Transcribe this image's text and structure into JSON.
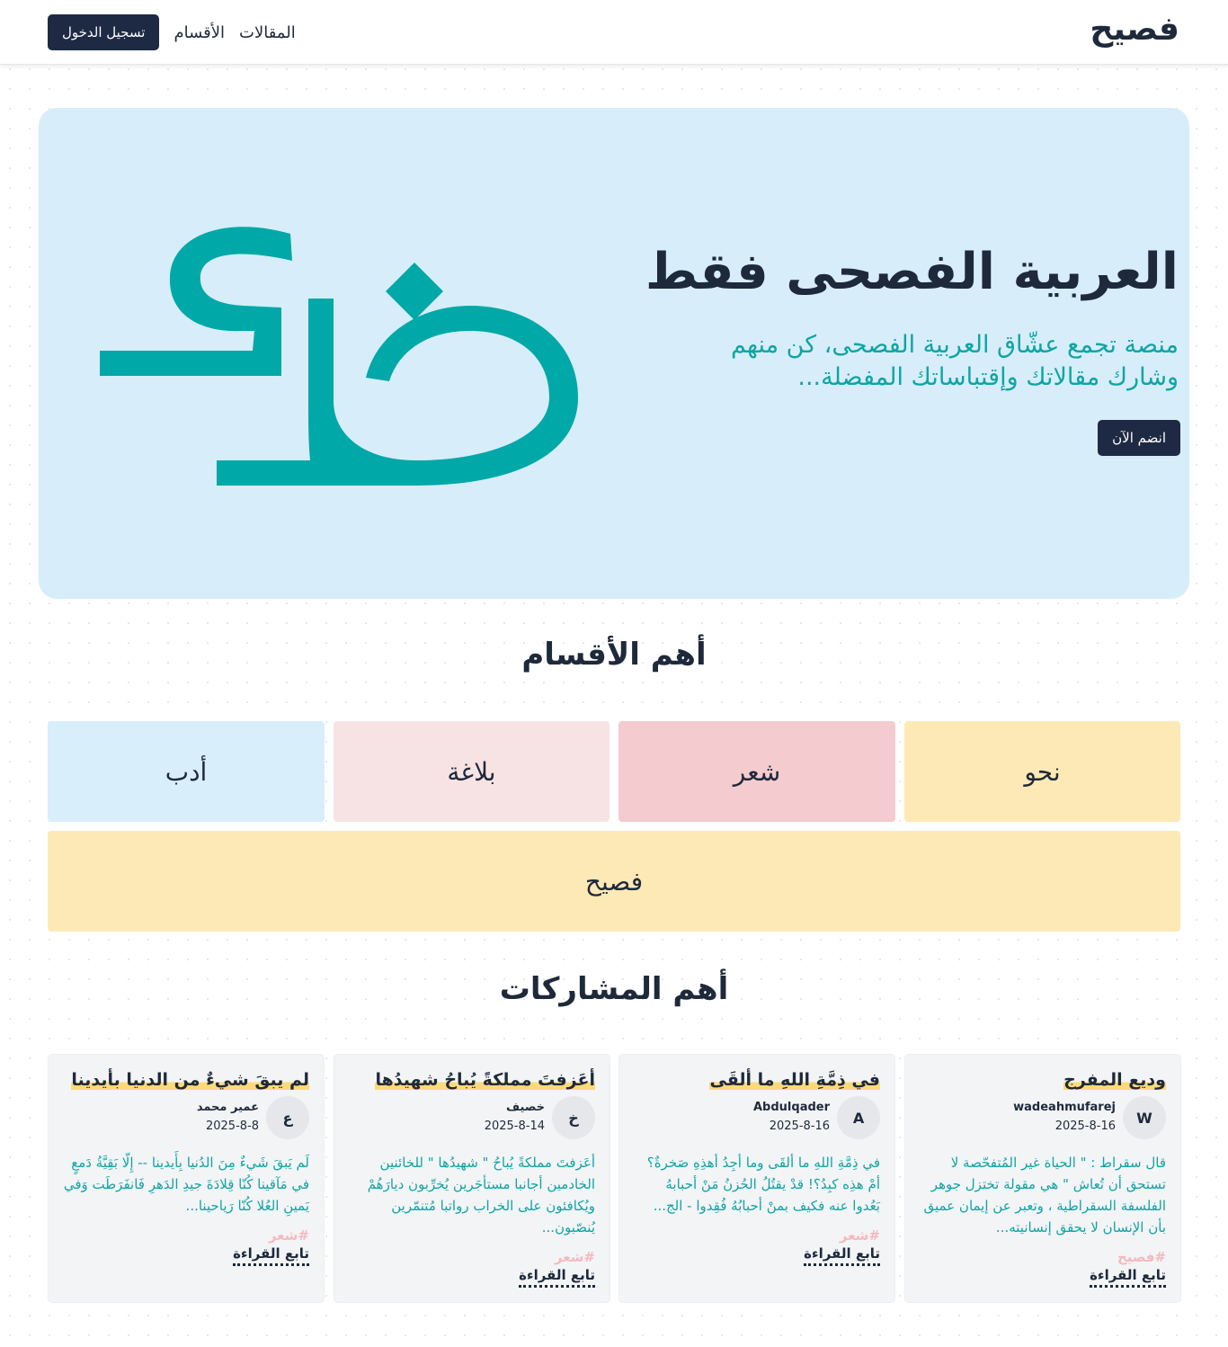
{
  "brand": {
    "logo": "فصيح"
  },
  "nav": {
    "login_label": "تسجيل الدخول",
    "categories_label": "الأقسام",
    "articles_label": "المقالات"
  },
  "hero": {
    "title": "العربية الفصحى فقط",
    "subtitle": "منصة تجمع عشّاق العربية الفصحى، كن منهم وشارك مقالاتك وإقتباساتك المفضلة...",
    "cta_label": "انضم الآن",
    "art_letters": "ضع",
    "colors": {
      "background": "#d7edf9",
      "accent": "#00a8a8"
    }
  },
  "categories_section": {
    "title": "أهم الأقسام",
    "items": [
      {
        "label": "نحو",
        "color": "#fde9b5"
      },
      {
        "label": "شعر",
        "color": "#f4cbcf"
      },
      {
        "label": "بلاغة",
        "color": "#f8e3e4"
      },
      {
        "label": "أدب",
        "color": "#d8eefa"
      },
      {
        "label": "فصيح",
        "color": "#fde9b5"
      }
    ]
  },
  "posts_section": {
    "title": "أهم المشاركات",
    "read_more_label": "تابع القراءة",
    "posts": [
      {
        "title": "وديع المفرج",
        "author": "wadeahmufarej",
        "avatar": "W",
        "date": "2025-8-16",
        "excerpt": "قال سقراط : \" الحياة غير المُتفحّصة لا تستحق أن تُعاش \" هي مقولة تختزل جوهر الفلسفة السقراطية ، وتعبر عن إيمان عميق بأن الإنسان لا يحقق إنسانيته...",
        "tag": "#فصيح"
      },
      {
        "title": "في ذِمَّةِ اللهِ ما ألقَى",
        "author": "Abdulqader",
        "avatar": "A",
        "date": "2025-8-16",
        "excerpt": "في ذِمَّةِ اللهِ ما ألقَى وما أجِدُ أهذِهِ صَخرةٌ؟ أمْ هذِه كبِدُ؟! قدْ يقتُلُ الحُزنُ مَنْ أحبابهُ بَعُدوا عنه فكيف بمنْ أحبابُهُ فُقِدوا - الج...",
        "tag": "#شعر"
      },
      {
        "title": "أعَزفتَ مملكةً يُباحُ شهيدُها",
        "author": "خصيف",
        "avatar": "خ",
        "date": "2025-8-14",
        "excerpt": "أعَزفتَ مملكةً يُباحُ \" شهيدُها \" للخائنين الخادمين أجانبا مستأجَرين يُخرِّبون ديارَهُمْ ويُكافئون على الخراب رواتبا مُتنمّرين يُنصّبون...",
        "tag": "#شعر"
      },
      {
        "title": "لم يبقَ شيءٌ من الدنيا بأيدينا",
        "author": "عمير محمد",
        "avatar": "ع",
        "date": "2025-8-8",
        "excerpt": "لَم يَبقَ شَيءٌ مِنَ الدُنيا بِأَيدينا -- إِلّا بَقِيَّةُ دَمعٍ في مَآقينا كُنّا قِلادَةَ جيدِ الدَهرِ فَانفَرَطَت وَفي يَمينِ العُلا كُنّا رَياحينا...",
        "tag": "#شعر"
      }
    ]
  }
}
